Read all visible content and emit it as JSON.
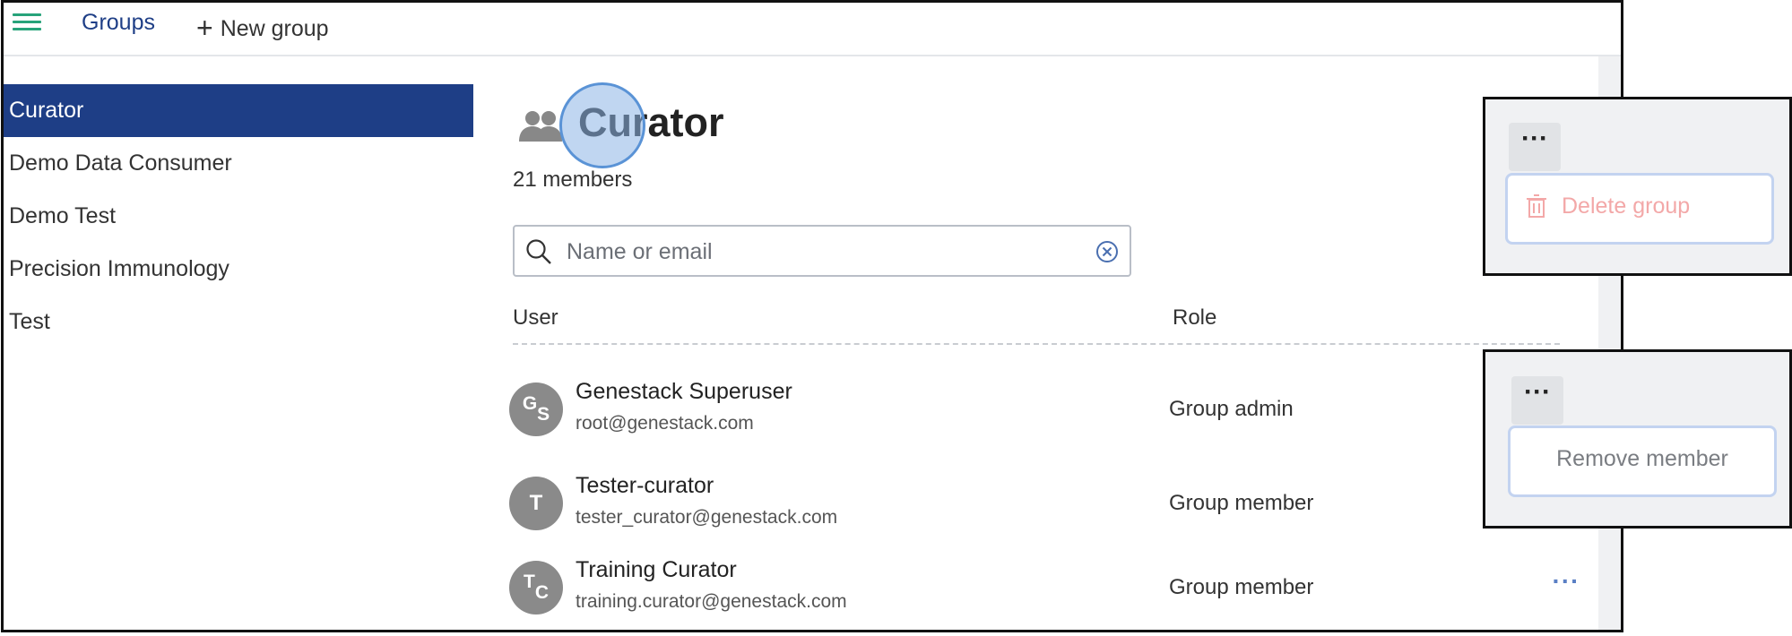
{
  "topbar": {
    "menu_icon": "hamburger-menu-icon",
    "groups_label": "Groups",
    "new_group_icon": "plus-icon",
    "new_group_label": "New group"
  },
  "sidebar": {
    "items": [
      {
        "label": "Curator",
        "active": true
      },
      {
        "label": "Demo Data Consumer",
        "active": false
      },
      {
        "label": "Demo Test",
        "active": false
      },
      {
        "label": "Precision Immunology",
        "active": false
      },
      {
        "label": "Test",
        "active": false
      }
    ]
  },
  "group": {
    "icon": "users-icon",
    "title": "Curator",
    "members_count": "21 members"
  },
  "search": {
    "placeholder": "Name or email",
    "value": ""
  },
  "table": {
    "columns": [
      "User",
      "Role"
    ],
    "rows": [
      {
        "initials": [
          "G",
          "S"
        ],
        "name": "Genestack Superuser",
        "email": "root@genestack.com",
        "role": "Group admin"
      },
      {
        "initials": [
          "T",
          ""
        ],
        "name": "Tester-curator",
        "email": "tester_curator@genestack.com",
        "role": "Group member"
      },
      {
        "initials": [
          "T",
          "C"
        ],
        "name": "Training Curator",
        "email": "training.curator@genestack.com",
        "role": "Group member"
      }
    ]
  },
  "callouts": {
    "group_menu": {
      "more_label": "···",
      "item_label": "Delete group",
      "item_icon": "trash-icon"
    },
    "member_menu": {
      "more_label": "···",
      "item_label": "Remove member"
    }
  },
  "colors": {
    "accent_navy": "#1e3e86",
    "menu_green": "#27a37a",
    "avatar_gray": "#8a8a8a",
    "danger_light": "#f3a8a8",
    "link_blue": "#5a7fc4"
  }
}
